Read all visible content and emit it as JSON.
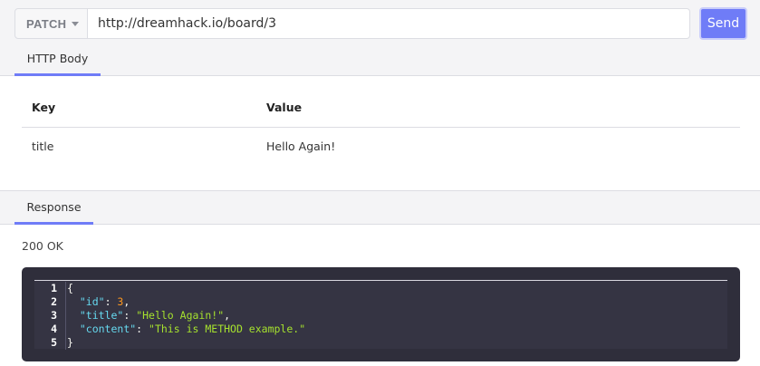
{
  "request": {
    "method": "PATCH",
    "url": "http://dreamhack.io/board/3",
    "send_label": "Send",
    "body_tab_label": "HTTP Body"
  },
  "body_table": {
    "headers": {
      "key": "Key",
      "value": "Value"
    },
    "rows": [
      {
        "key": "title",
        "value": "Hello Again!"
      }
    ]
  },
  "response": {
    "tab_label": "Response",
    "status": "200 OK",
    "line_numbers": [
      "1",
      "2",
      "3",
      "4",
      "5"
    ],
    "json_lines": [
      {
        "open": "{"
      },
      {
        "key": "\"id\"",
        "sep": ": ",
        "value": "3",
        "value_type": "number",
        "trail": ","
      },
      {
        "key": "\"title\"",
        "sep": ": ",
        "value": "\"Hello Again!\"",
        "value_type": "string",
        "trail": ","
      },
      {
        "key": "\"content\"",
        "sep": ": ",
        "value": "\"This is METHOD example.\"",
        "value_type": "string",
        "trail": ""
      },
      {
        "close": "}"
      }
    ]
  },
  "colors": {
    "accent": "#6f7cf7",
    "code_bg": "#2f2e3b",
    "json_key": "#66d9ef",
    "json_number": "#fd971f",
    "json_string": "#a6e22e"
  }
}
